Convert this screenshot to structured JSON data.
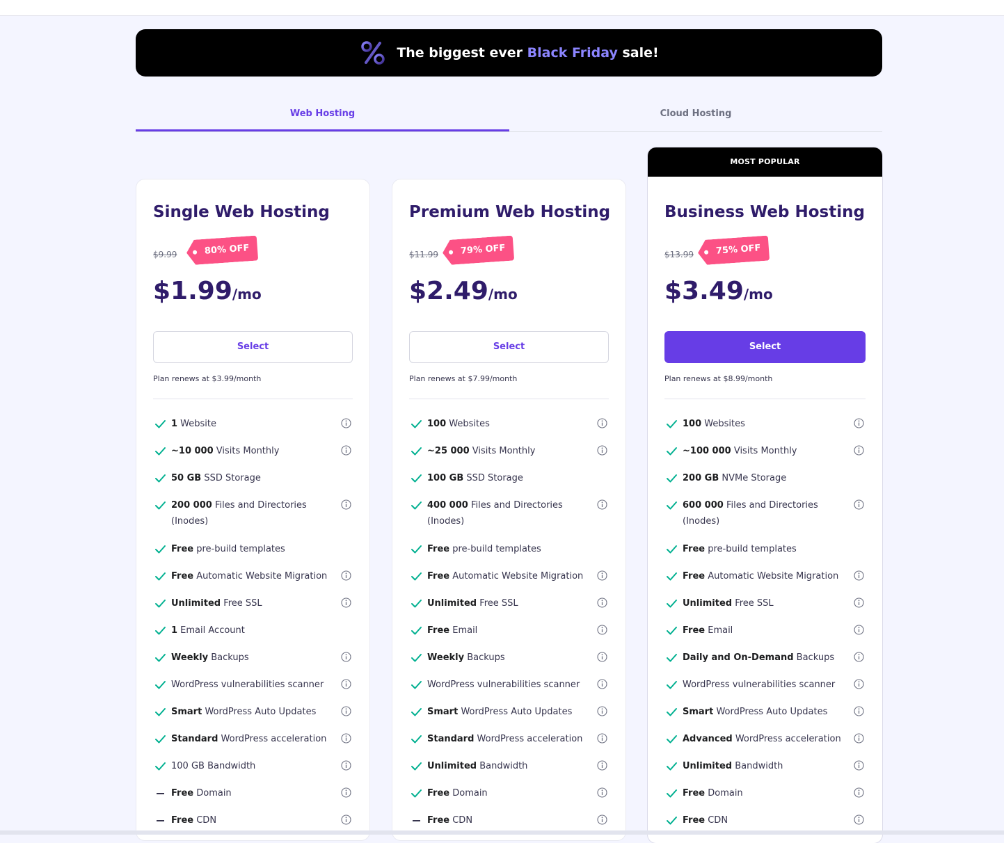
{
  "banner": {
    "text_prefix": "The biggest ever ",
    "highlight": "Black Friday",
    "text_suffix": " sale!",
    "icon": "percent-icon"
  },
  "tabs": [
    {
      "label": "Web Hosting",
      "active": true
    },
    {
      "label": "Cloud Hosting",
      "active": false
    }
  ],
  "colors": {
    "accent": "#673de6",
    "discount": "#fc5185",
    "check": "#00b090",
    "heading": "#2f1c6a"
  },
  "plans": [
    {
      "name": "Single Web Hosting",
      "old_price": "$9.99",
      "discount": "80% OFF",
      "price": "$1.99",
      "per": "/mo",
      "select_label": "Select",
      "renews": "Plan renews at $3.99/month",
      "features": [
        {
          "bold": "1",
          "text": " Website",
          "included": true,
          "info": true
        },
        {
          "bold": "~10 000",
          "text": " Visits Monthly",
          "included": true,
          "info": true
        },
        {
          "bold": "50 GB",
          "text": " SSD Storage",
          "included": true,
          "info": false
        },
        {
          "bold": "200 000",
          "text": " Files and Directories (Inodes)",
          "included": true,
          "info": true
        },
        {
          "bold": "Free",
          "text": " pre-build templates",
          "included": true,
          "info": false
        },
        {
          "bold": "Free",
          "text": " Automatic Website Migration",
          "included": true,
          "info": true
        },
        {
          "bold": "Unlimited",
          "text": " Free SSL",
          "included": true,
          "info": true
        },
        {
          "bold": "1",
          "text": " Email Account",
          "included": true,
          "info": false
        },
        {
          "bold": "Weekly",
          "text": " Backups",
          "included": true,
          "info": true
        },
        {
          "bold": "",
          "text": "WordPress vulnerabilities scanner",
          "included": true,
          "info": true
        },
        {
          "bold": "Smart",
          "text": " WordPress Auto Updates",
          "included": true,
          "info": true
        },
        {
          "bold": "Standard",
          "text": " WordPress acceleration",
          "included": true,
          "info": true
        },
        {
          "bold": "",
          "text": "100 GB Bandwidth",
          "included": true,
          "info": true
        },
        {
          "bold": "Free",
          "text": " Domain",
          "included": false,
          "info": true
        },
        {
          "bold": "Free",
          "text": " CDN",
          "included": false,
          "info": true
        }
      ]
    },
    {
      "name": "Premium Web Hosting",
      "old_price": "$11.99",
      "discount": "79% OFF",
      "price": "$2.49",
      "per": "/mo",
      "select_label": "Select",
      "renews": "Plan renews at $7.99/month",
      "features": [
        {
          "bold": "100",
          "text": " Websites",
          "included": true,
          "info": true
        },
        {
          "bold": "~25 000",
          "text": " Visits Monthly",
          "included": true,
          "info": true
        },
        {
          "bold": "100 GB",
          "text": " SSD Storage",
          "included": true,
          "info": false
        },
        {
          "bold": "400 000",
          "text": " Files and Directories (Inodes)",
          "included": true,
          "info": true
        },
        {
          "bold": "Free",
          "text": " pre-build templates",
          "included": true,
          "info": false
        },
        {
          "bold": "Free",
          "text": " Automatic Website Migration",
          "included": true,
          "info": true
        },
        {
          "bold": "Unlimited",
          "text": " Free SSL",
          "included": true,
          "info": true
        },
        {
          "bold": "Free",
          "text": " Email",
          "included": true,
          "info": true
        },
        {
          "bold": "Weekly",
          "text": " Backups",
          "included": true,
          "info": true
        },
        {
          "bold": "",
          "text": "WordPress vulnerabilities scanner",
          "included": true,
          "info": true
        },
        {
          "bold": "Smart",
          "text": " WordPress Auto Updates",
          "included": true,
          "info": true
        },
        {
          "bold": "Standard",
          "text": " WordPress acceleration",
          "included": true,
          "info": true
        },
        {
          "bold": "Unlimited",
          "text": " Bandwidth",
          "included": true,
          "info": true
        },
        {
          "bold": "Free",
          "text": " Domain",
          "included": true,
          "info": true
        },
        {
          "bold": "Free",
          "text": " CDN",
          "included": false,
          "info": true
        }
      ]
    },
    {
      "name": "Business Web Hosting",
      "badge": "MOST POPULAR",
      "old_price": "$13.99",
      "discount": "75% OFF",
      "price": "$3.49",
      "per": "/mo",
      "select_label": "Select",
      "renews": "Plan renews at $8.99/month",
      "features": [
        {
          "bold": "100",
          "text": " Websites",
          "included": true,
          "info": true
        },
        {
          "bold": "~100 000",
          "text": " Visits Monthly",
          "included": true,
          "info": true
        },
        {
          "bold": "200 GB",
          "text": " NVMe Storage",
          "included": true,
          "info": false
        },
        {
          "bold": "600 000",
          "text": " Files and Directories (Inodes)",
          "included": true,
          "info": true
        },
        {
          "bold": "Free",
          "text": " pre-build templates",
          "included": true,
          "info": false
        },
        {
          "bold": "Free",
          "text": " Automatic Website Migration",
          "included": true,
          "info": true
        },
        {
          "bold": "Unlimited",
          "text": " Free SSL",
          "included": true,
          "info": true
        },
        {
          "bold": "Free",
          "text": " Email",
          "included": true,
          "info": true
        },
        {
          "bold": "Daily and On-Demand",
          "text": " Backups",
          "included": true,
          "info": true
        },
        {
          "bold": "",
          "text": "WordPress vulnerabilities scanner",
          "included": true,
          "info": true
        },
        {
          "bold": "Smart",
          "text": " WordPress Auto Updates",
          "included": true,
          "info": true
        },
        {
          "bold": "Advanced",
          "text": " WordPress acceleration",
          "included": true,
          "info": true
        },
        {
          "bold": "Unlimited",
          "text": " Bandwidth",
          "included": true,
          "info": true
        },
        {
          "bold": "Free",
          "text": " Domain",
          "included": true,
          "info": true
        },
        {
          "bold": "Free",
          "text": " CDN",
          "included": true,
          "info": true
        }
      ]
    }
  ]
}
